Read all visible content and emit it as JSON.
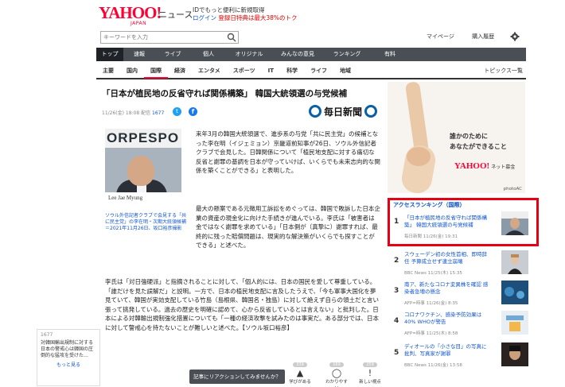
{
  "header": {
    "logo": "YAHOO!",
    "logo_sub": "JAPAN",
    "brand": "ニュース",
    "promo_line1": "IDでもっと便利に新規取得",
    "promo_login": "ログイン",
    "promo_line2": "登録日特典は最大38%のトク",
    "search_placeholder": "キーワードを入力",
    "my_page": "マイページ",
    "purchase_history": "購入履歴"
  },
  "topnav": [
    {
      "label": "トップ",
      "active": true
    },
    {
      "label": "速報"
    },
    {
      "label": "ライブ"
    },
    {
      "label": "個人"
    },
    {
      "label": "オリジナル"
    },
    {
      "label": "みんなの意見"
    },
    {
      "label": "ランキング"
    },
    {
      "label": "有料"
    }
  ],
  "subnav": [
    {
      "label": "主要"
    },
    {
      "label": "国内"
    },
    {
      "label": "国際",
      "active": true
    },
    {
      "label": "経済"
    },
    {
      "label": "エンタメ"
    },
    {
      "label": "スポーツ"
    },
    {
      "label": "IT"
    },
    {
      "label": "科学"
    },
    {
      "label": "ライフ"
    },
    {
      "label": "地域"
    }
  ],
  "subnav_right": "トピックス一覧",
  "article": {
    "title": "「日本が植民地の反省守れば関係構築」 韓国大統領選の与党候補",
    "meta_date": "11/26(金) 18:08 配信",
    "meta_count": "1677",
    "source": "毎日新聞",
    "photo_name": "Lee Jae Myung",
    "photo_caption": "ソウル外信記者クラブで会見する「共に民主党」の李在明・次期大統領候補＝2021年11月26日、坂口裕彦撮影",
    "p1": "来年3月の韓国大統領選で、進歩系の与党「共に民主党」の候補となった李在明（イジェミョン）京畿道前知事が26日、ソウル外信記者クラブで会見した。日韓関係について「植民地支配に対する痛切な反省と謝罪の基調を日本が守っていけば、いくらでも未来志向的な関係を築くことができる」と表明した。",
    "p2": "最大の懸案である元徴用工訴訟をめぐっては、韓国で敗訴した日本企業の資産の現金化に向けた手続きが進んでいる。李氏は「被害者は金ではなく謝罪を求めている」「日本側が（真摯に）謝罪すれば、最終的に残った賠償問題は、現実的な解決策がいくらでも探すことができる」と述べた。",
    "p3": "李氏は「対日強硬派」と指摘されることに対して、「個人的には、日本の国民を愛して尊重している。「誰だけを見た誤解だ」と説明。一方で、日本の植民地支配に言及したうえで、「今も軍事大国化を夢見ていて、韓国が実効支配している竹島（島根県、韓国名・独島）に対して絶えず自らの領土だと言い張って挑発している。過去の歴史を明確に認めて、心から反省しているとは言えない」と批判した。日本による対韓輸出規制強化措置についても「一種の経済攻撃を試みたのは事実だ。ある部分では、日本に対して警戒心を持たないことが難しいと述べた。【ソウル坂口裕彦】"
  },
  "ad": {
    "copy_line1": "誰かのために",
    "copy_line2": "あなたができること",
    "logo": "YAHOO!",
    "logo_sub": "ネット募金",
    "credit": "photoAC"
  },
  "ranking": {
    "title": "アクセスランキング（国際）",
    "items": [
      {
        "num": "1",
        "title": "「日本が植民地の反省守れば関係構築」 韓国大統領選の与党候補",
        "source": "毎日新聞 11/26(金) 19:31"
      },
      {
        "num": "2",
        "title": "スウェーデン初の女性首相、即時辞任 予算成立せず連立崩壊",
        "source": "BBC News 11/25(木) 15:35"
      },
      {
        "num": "3",
        "title": "南ア、新たなコロナ変異株を確認 感染者急増の懸念",
        "source": "AFP=時事 11/26(金) 8:35"
      },
      {
        "num": "4",
        "title": "コロナワクチン、感染予防効果は40% WHOが警告",
        "source": "AFP=時事 11/25(木) 8:58"
      },
      {
        "num": "5",
        "title": "ディオールの「小さな目」の写真に批判、写真家が謝罪",
        "source": "BBC News 11/26(金) 13:58"
      }
    ]
  },
  "left_widget": {
    "count": "1677",
    "text": "対韓国輸出規制に対する日本の警戒心は韓国の圧倒的な猛攻を受けた…",
    "more": "もっと見る"
  },
  "bottom": {
    "bar": "記事にリアクションしてみませんか？",
    "btn1_label": "学びがある",
    "btn1_count": "339",
    "btn2_label": "わかりやすい",
    "btn2_count": "169",
    "btn3_label": "新しい視点",
    "btn3_count": "259"
  }
}
